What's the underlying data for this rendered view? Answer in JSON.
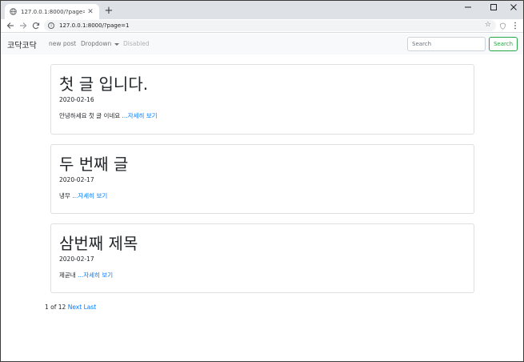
{
  "browser": {
    "tab_title": "127.0.0.1:8000/?page=1",
    "url": "127.0.0.1:8000/?page=1",
    "icons": {
      "favicon": "globe-icon",
      "close": "close-icon",
      "new_tab": "plus-icon",
      "back": "back-arrow-icon",
      "forward": "forward-arrow-icon",
      "reload": "reload-icon",
      "info": "info-icon",
      "bookmark": "star-icon",
      "extension": "shield-icon",
      "menu": "kebab-menu-icon",
      "minimize": "minimize-icon",
      "maximize": "maximize-icon",
      "window_close": "close-icon"
    }
  },
  "navbar": {
    "brand": "코닥코닥",
    "links": [
      "new post",
      "Dropdown",
      "Disabled"
    ],
    "search_placeholder": "Search",
    "search_button": "Search",
    "colors": {
      "background": "#f8f9fa",
      "accent": "#28a745"
    }
  },
  "posts": [
    {
      "title": "첫 글 입니다.",
      "date": "2020-02-16",
      "excerpt": "안녕하세요 첫 글 이네요",
      "more": "...자세히 보기"
    },
    {
      "title": "두 번째 글",
      "date": "2020-02-17",
      "excerpt": "냉무",
      "more": "...자세히 보기"
    },
    {
      "title": "삼번째 제목",
      "date": "2020-02-17",
      "excerpt": "제곧내",
      "more": "...자세히 보기"
    }
  ],
  "pagination": {
    "status": "1 of 12",
    "next": "Next",
    "last": "Last"
  },
  "colors": {
    "link": "#007bff"
  }
}
